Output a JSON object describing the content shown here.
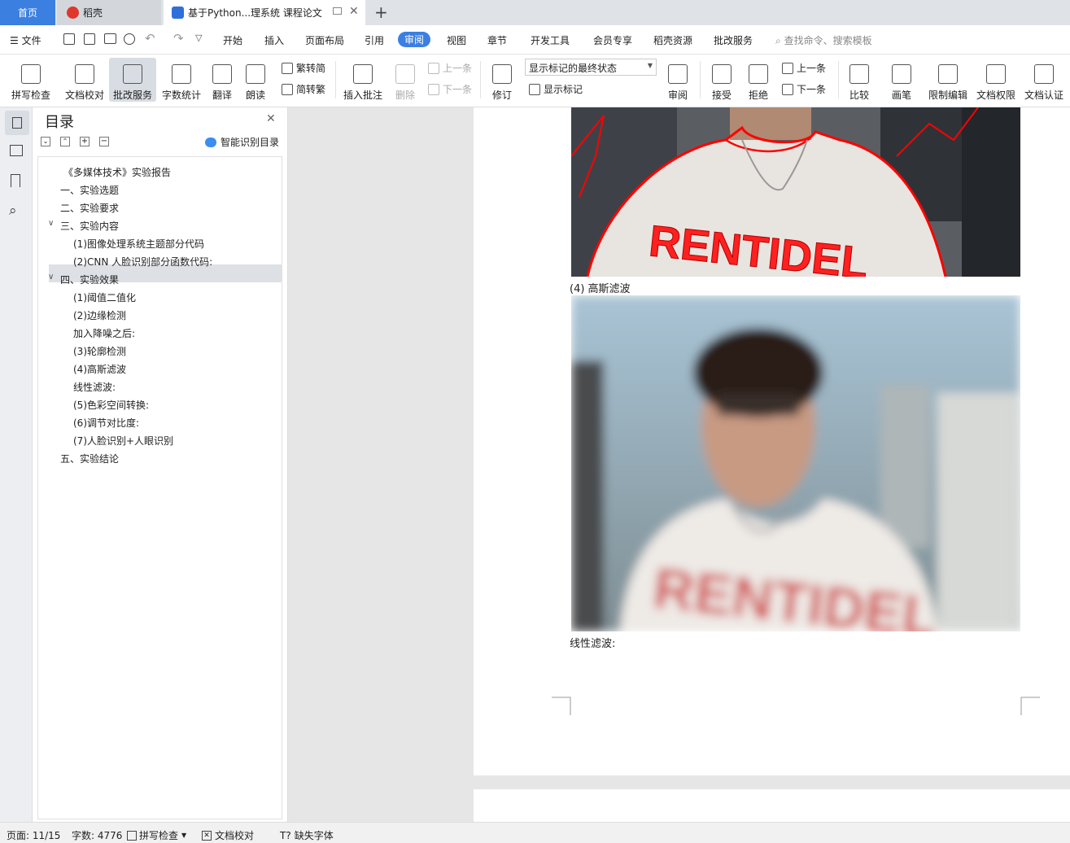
{
  "tabs": {
    "home": "首页",
    "daoke": "稻壳",
    "doc": "基于Python...理系统 课程论文"
  },
  "menu": {
    "file": "文件",
    "start": "开始",
    "insert": "插入",
    "layout": "页面布局",
    "reference": "引用",
    "review": "审阅",
    "view": "视图",
    "chapter": "章节",
    "devtools": "开发工具",
    "member": "会员专享",
    "daoke_res": "稻壳资源",
    "grading": "批改服务",
    "search": "查找命令、搜索模板"
  },
  "ribbon": {
    "spell": "拼写检查",
    "proof": "文档校对",
    "grade": "批改服务",
    "wordcount": "字数统计",
    "translate": "翻译",
    "read": "朗读",
    "trad2simp": "繁转简",
    "simp2trad": "简转繁",
    "insert_comment": "插入批注",
    "delete": "删除",
    "prev_comment": "上一条",
    "next_comment": "下一条",
    "revise": "修订",
    "markup_state": "显示标记的最终状态",
    "show_markup": "显示标记",
    "review": "审阅",
    "accept": "接受",
    "reject": "拒绝",
    "prev_change": "上一条",
    "next_change": "下一条",
    "compare": "比较",
    "pen": "画笔",
    "restrict": "限制编辑",
    "permission": "文档权限",
    "certify": "文档认证"
  },
  "panel": {
    "title": "目录",
    "smart": "智能识别目录",
    "items": [
      "《多媒体技术》实验报告",
      "一、实验选题",
      "二、实验要求",
      "三、实验内容",
      "(1)图像处理系统主题部分代码",
      "(2)CNN 人脸识别部分函数代码:",
      "四、实验效果",
      "(1)阈值二值化",
      "(2)边缘检测",
      "加入降噪之后:",
      "(3)轮廓检测",
      "(4)高斯滤波",
      "线性滤波:",
      "(5)色彩空间转换:",
      "(6)调节对比度:",
      "(7)人脸识别+人眼识别",
      "五、实验结论"
    ]
  },
  "document": {
    "caption1": "(4) 高斯滤波",
    "caption2": "线性滤波:"
  },
  "status": {
    "page": "页面: 11/15",
    "words": "字数: 4776",
    "spell": "拼写检查",
    "proof": "文档校对",
    "font": "缺失字体"
  }
}
